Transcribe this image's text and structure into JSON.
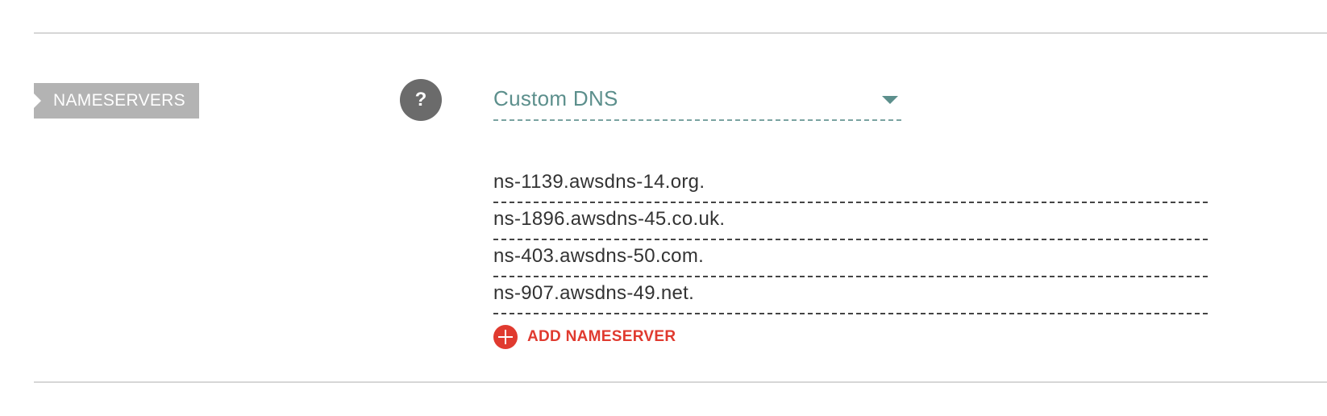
{
  "nameservers_section": {
    "label": "NAMESERVERS",
    "help_symbol": "?",
    "dns_type": {
      "selected": "Custom DNS"
    },
    "entries": [
      "ns-1139.awsdns-14.org.",
      "ns-1896.awsdns-45.co.uk.",
      "ns-403.awsdns-50.com.",
      "ns-907.awsdns-49.net."
    ],
    "add_button_label": "ADD NAMESERVER"
  },
  "colors": {
    "label_bg": "#b3b3b3",
    "accent_teal": "#5c8f8c",
    "add_red": "#e03a2f",
    "help_icon_bg": "#6b6b6b"
  },
  "icons": {
    "help": "question-circle-icon",
    "dropdown": "chevron-down-icon",
    "add": "plus-circle-icon"
  }
}
